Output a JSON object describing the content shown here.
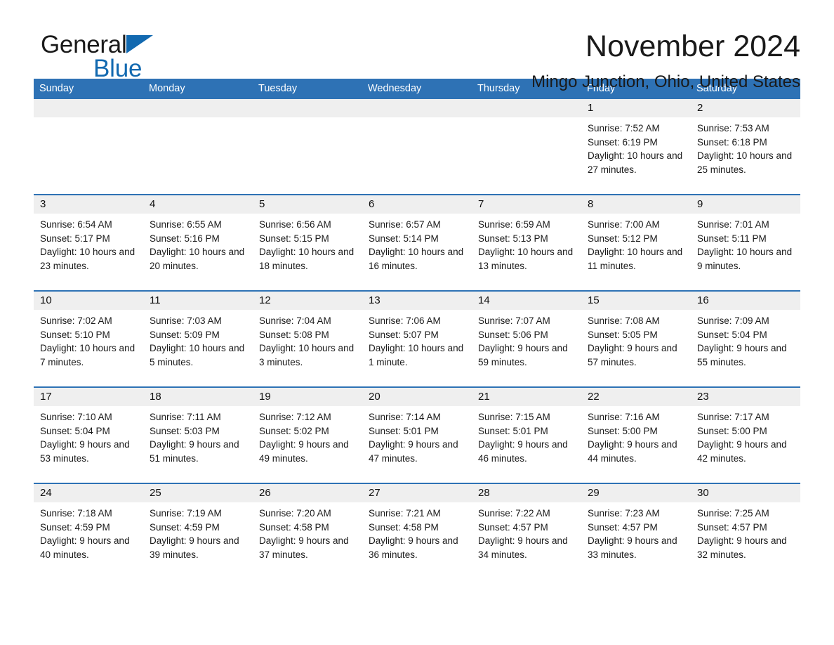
{
  "logo": {
    "word1": "General",
    "word2": "Blue",
    "triangle_color": "#1269b0"
  },
  "header": {
    "month_title": "November 2024",
    "location": "Mingo Junction, Ohio, United States"
  },
  "colors": {
    "header_blue": "#2e72b5",
    "daynum_band": "#efefef",
    "row_rule": "#2e72b5"
  },
  "weekday_headers": [
    "Sunday",
    "Monday",
    "Tuesday",
    "Wednesday",
    "Thursday",
    "Friday",
    "Saturday"
  ],
  "weeks": [
    [
      {
        "day": "",
        "sunrise": "",
        "sunset": "",
        "daylight": "",
        "empty": true
      },
      {
        "day": "",
        "sunrise": "",
        "sunset": "",
        "daylight": "",
        "empty": true
      },
      {
        "day": "",
        "sunrise": "",
        "sunset": "",
        "daylight": "",
        "empty": true
      },
      {
        "day": "",
        "sunrise": "",
        "sunset": "",
        "daylight": "",
        "empty": true
      },
      {
        "day": "",
        "sunrise": "",
        "sunset": "",
        "daylight": "",
        "empty": true
      },
      {
        "day": "1",
        "sunrise": "Sunrise: 7:52 AM",
        "sunset": "Sunset: 6:19 PM",
        "daylight": "Daylight: 10 hours and 27 minutes.",
        "empty": false
      },
      {
        "day": "2",
        "sunrise": "Sunrise: 7:53 AM",
        "sunset": "Sunset: 6:18 PM",
        "daylight": "Daylight: 10 hours and 25 minutes.",
        "empty": false
      }
    ],
    [
      {
        "day": "3",
        "sunrise": "Sunrise: 6:54 AM",
        "sunset": "Sunset: 5:17 PM",
        "daylight": "Daylight: 10 hours and 23 minutes.",
        "empty": false
      },
      {
        "day": "4",
        "sunrise": "Sunrise: 6:55 AM",
        "sunset": "Sunset: 5:16 PM",
        "daylight": "Daylight: 10 hours and 20 minutes.",
        "empty": false
      },
      {
        "day": "5",
        "sunrise": "Sunrise: 6:56 AM",
        "sunset": "Sunset: 5:15 PM",
        "daylight": "Daylight: 10 hours and 18 minutes.",
        "empty": false
      },
      {
        "day": "6",
        "sunrise": "Sunrise: 6:57 AM",
        "sunset": "Sunset: 5:14 PM",
        "daylight": "Daylight: 10 hours and 16 minutes.",
        "empty": false
      },
      {
        "day": "7",
        "sunrise": "Sunrise: 6:59 AM",
        "sunset": "Sunset: 5:13 PM",
        "daylight": "Daylight: 10 hours and 13 minutes.",
        "empty": false
      },
      {
        "day": "8",
        "sunrise": "Sunrise: 7:00 AM",
        "sunset": "Sunset: 5:12 PM",
        "daylight": "Daylight: 10 hours and 11 minutes.",
        "empty": false
      },
      {
        "day": "9",
        "sunrise": "Sunrise: 7:01 AM",
        "sunset": "Sunset: 5:11 PM",
        "daylight": "Daylight: 10 hours and 9 minutes.",
        "empty": false
      }
    ],
    [
      {
        "day": "10",
        "sunrise": "Sunrise: 7:02 AM",
        "sunset": "Sunset: 5:10 PM",
        "daylight": "Daylight: 10 hours and 7 minutes.",
        "empty": false
      },
      {
        "day": "11",
        "sunrise": "Sunrise: 7:03 AM",
        "sunset": "Sunset: 5:09 PM",
        "daylight": "Daylight: 10 hours and 5 minutes.",
        "empty": false
      },
      {
        "day": "12",
        "sunrise": "Sunrise: 7:04 AM",
        "sunset": "Sunset: 5:08 PM",
        "daylight": "Daylight: 10 hours and 3 minutes.",
        "empty": false
      },
      {
        "day": "13",
        "sunrise": "Sunrise: 7:06 AM",
        "sunset": "Sunset: 5:07 PM",
        "daylight": "Daylight: 10 hours and 1 minute.",
        "empty": false
      },
      {
        "day": "14",
        "sunrise": "Sunrise: 7:07 AM",
        "sunset": "Sunset: 5:06 PM",
        "daylight": "Daylight: 9 hours and 59 minutes.",
        "empty": false
      },
      {
        "day": "15",
        "sunrise": "Sunrise: 7:08 AM",
        "sunset": "Sunset: 5:05 PM",
        "daylight": "Daylight: 9 hours and 57 minutes.",
        "empty": false
      },
      {
        "day": "16",
        "sunrise": "Sunrise: 7:09 AM",
        "sunset": "Sunset: 5:04 PM",
        "daylight": "Daylight: 9 hours and 55 minutes.",
        "empty": false
      }
    ],
    [
      {
        "day": "17",
        "sunrise": "Sunrise: 7:10 AM",
        "sunset": "Sunset: 5:04 PM",
        "daylight": "Daylight: 9 hours and 53 minutes.",
        "empty": false
      },
      {
        "day": "18",
        "sunrise": "Sunrise: 7:11 AM",
        "sunset": "Sunset: 5:03 PM",
        "daylight": "Daylight: 9 hours and 51 minutes.",
        "empty": false
      },
      {
        "day": "19",
        "sunrise": "Sunrise: 7:12 AM",
        "sunset": "Sunset: 5:02 PM",
        "daylight": "Daylight: 9 hours and 49 minutes.",
        "empty": false
      },
      {
        "day": "20",
        "sunrise": "Sunrise: 7:14 AM",
        "sunset": "Sunset: 5:01 PM",
        "daylight": "Daylight: 9 hours and 47 minutes.",
        "empty": false
      },
      {
        "day": "21",
        "sunrise": "Sunrise: 7:15 AM",
        "sunset": "Sunset: 5:01 PM",
        "daylight": "Daylight: 9 hours and 46 minutes.",
        "empty": false
      },
      {
        "day": "22",
        "sunrise": "Sunrise: 7:16 AM",
        "sunset": "Sunset: 5:00 PM",
        "daylight": "Daylight: 9 hours and 44 minutes.",
        "empty": false
      },
      {
        "day": "23",
        "sunrise": "Sunrise: 7:17 AM",
        "sunset": "Sunset: 5:00 PM",
        "daylight": "Daylight: 9 hours and 42 minutes.",
        "empty": false
      }
    ],
    [
      {
        "day": "24",
        "sunrise": "Sunrise: 7:18 AM",
        "sunset": "Sunset: 4:59 PM",
        "daylight": "Daylight: 9 hours and 40 minutes.",
        "empty": false
      },
      {
        "day": "25",
        "sunrise": "Sunrise: 7:19 AM",
        "sunset": "Sunset: 4:59 PM",
        "daylight": "Daylight: 9 hours and 39 minutes.",
        "empty": false
      },
      {
        "day": "26",
        "sunrise": "Sunrise: 7:20 AM",
        "sunset": "Sunset: 4:58 PM",
        "daylight": "Daylight: 9 hours and 37 minutes.",
        "empty": false
      },
      {
        "day": "27",
        "sunrise": "Sunrise: 7:21 AM",
        "sunset": "Sunset: 4:58 PM",
        "daylight": "Daylight: 9 hours and 36 minutes.",
        "empty": false
      },
      {
        "day": "28",
        "sunrise": "Sunrise: 7:22 AM",
        "sunset": "Sunset: 4:57 PM",
        "daylight": "Daylight: 9 hours and 34 minutes.",
        "empty": false
      },
      {
        "day": "29",
        "sunrise": "Sunrise: 7:23 AM",
        "sunset": "Sunset: 4:57 PM",
        "daylight": "Daylight: 9 hours and 33 minutes.",
        "empty": false
      },
      {
        "day": "30",
        "sunrise": "Sunrise: 7:25 AM",
        "sunset": "Sunset: 4:57 PM",
        "daylight": "Daylight: 9 hours and 32 minutes.",
        "empty": false
      }
    ]
  ]
}
